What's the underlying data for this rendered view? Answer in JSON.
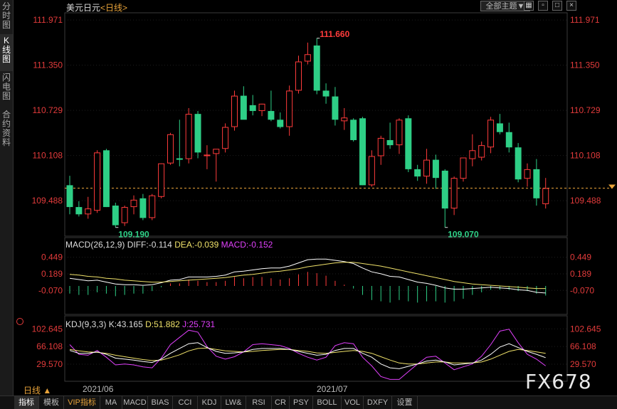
{
  "left_tabs": [
    {
      "label": "分时图",
      "active": false
    },
    {
      "label": "K线图",
      "active": true
    },
    {
      "label": "闪电图",
      "active": false
    },
    {
      "label": "合约资料",
      "active": false
    }
  ],
  "header": {
    "symbol": "美元日元",
    "period": "<日线>",
    "theme_button": "全部主题▼"
  },
  "price_axis_labels": [
    "111.971",
    "111.350",
    "110.729",
    "110.108",
    "109.488"
  ],
  "macd_axis_labels": [
    "0.449",
    "0.189",
    "-0.070"
  ],
  "kdj_axis_labels": [
    "102.645",
    "66.108",
    "29.570"
  ],
  "macd_title": {
    "name": "MACD(26,12,9)",
    "diff": "DIFF:-0.114",
    "dea": "DEA:-0.039",
    "macd": "MACD:-0.152"
  },
  "kdj_title": {
    "name": "KDJ(9,3,3)",
    "k": "K:43.165",
    "d": "D:51.882",
    "j": "J:25.731"
  },
  "date_labels": [
    "2021/06",
    "2021/07"
  ],
  "period_button": "日线 ▲",
  "bottom_tabs": [
    "指标",
    "模板",
    "VIP指标",
    "MA",
    "MACD",
    "BIAS",
    "CCI",
    "KDJ",
    "LW&",
    "RSI",
    "CR",
    "PSY",
    "BOLL",
    "VOL",
    "DXFY",
    "设置"
  ],
  "watermark": "FX678",
  "colors": {
    "up": "#ff3b3b",
    "down": "#2ecf86",
    "dif": "#ffffff",
    "dea": "#f0e26a",
    "j": "#e040fb",
    "axis_text": "#e33b3b"
  },
  "chart_data": {
    "type": "candlestick",
    "symbol": "USDJPY",
    "period": "daily",
    "ylim": [
      109.0,
      112.05
    ],
    "current_price": 109.66,
    "annotations": {
      "max": "111.660",
      "min_left": "109.190",
      "min_right": "109.070"
    },
    "ohlc": [
      [
        109.7,
        109.83,
        109.3,
        109.4
      ],
      [
        109.4,
        109.48,
        109.27,
        109.3
      ],
      [
        109.3,
        109.54,
        109.24,
        109.38
      ],
      [
        109.35,
        110.18,
        109.32,
        110.15
      ],
      [
        110.18,
        110.2,
        109.4,
        109.4
      ],
      [
        109.42,
        109.46,
        109.12,
        109.15
      ],
      [
        109.18,
        109.42,
        109.14,
        109.4
      ],
      [
        109.4,
        109.56,
        109.3,
        109.5
      ],
      [
        109.52,
        109.58,
        109.22,
        109.25
      ],
      [
        109.25,
        109.58,
        109.22,
        109.56
      ],
      [
        109.54,
        110.0,
        109.52,
        110.0
      ],
      [
        110.0,
        110.42,
        109.98,
        110.4
      ],
      [
        110.07,
        110.6,
        109.96,
        110.05
      ],
      [
        110.06,
        110.76,
        110.0,
        110.68
      ],
      [
        110.68,
        110.72,
        110.07,
        110.15
      ],
      [
        110.1,
        110.25,
        109.92,
        110.12
      ],
      [
        110.13,
        110.19,
        109.75,
        110.2
      ],
      [
        110.2,
        110.55,
        110.15,
        110.5
      ],
      [
        110.5,
        111.0,
        110.45,
        110.93
      ],
      [
        110.93,
        111.06,
        110.65,
        110.6
      ],
      [
        110.8,
        110.94,
        110.66,
        110.72
      ],
      [
        110.72,
        110.82,
        110.65,
        110.82
      ],
      [
        110.72,
        111.0,
        110.58,
        110.6
      ],
      [
        110.6,
        110.7,
        110.48,
        110.5
      ],
      [
        110.5,
        111.07,
        110.38,
        111.0
      ],
      [
        111.0,
        111.48,
        110.96,
        111.4
      ],
      [
        111.4,
        111.66,
        111.36,
        111.5
      ],
      [
        111.62,
        111.72,
        110.95,
        111.0
      ],
      [
        111.0,
        111.1,
        110.82,
        110.92
      ],
      [
        110.92,
        111.05,
        110.52,
        110.6
      ],
      [
        110.58,
        110.76,
        110.46,
        110.63
      ],
      [
        110.6,
        110.62,
        110.3,
        110.32
      ],
      [
        110.62,
        110.64,
        109.7,
        109.7
      ],
      [
        109.7,
        110.18,
        109.68,
        110.1
      ],
      [
        110.1,
        110.38,
        109.98,
        110.35
      ],
      [
        110.32,
        110.56,
        110.2,
        110.25
      ],
      [
        110.25,
        110.62,
        110.13,
        110.6
      ],
      [
        110.62,
        110.66,
        109.88,
        109.92
      ],
      [
        109.92,
        109.98,
        109.76,
        109.82
      ],
      [
        109.82,
        110.2,
        109.72,
        110.05
      ],
      [
        110.05,
        110.12,
        109.65,
        109.8
      ],
      [
        109.9,
        109.92,
        109.12,
        109.38
      ],
      [
        109.38,
        109.82,
        109.29,
        109.8
      ],
      [
        109.79,
        110.05,
        109.75,
        110.08
      ],
      [
        110.06,
        110.4,
        109.96,
        110.18
      ],
      [
        110.08,
        110.3,
        110.04,
        110.25
      ],
      [
        110.22,
        110.64,
        110.14,
        110.6
      ],
      [
        110.55,
        110.68,
        110.4,
        110.43
      ],
      [
        110.43,
        110.56,
        110.15,
        110.22
      ],
      [
        110.22,
        110.28,
        109.74,
        109.78
      ],
      [
        109.79,
        110.0,
        109.68,
        109.92
      ],
      [
        109.92,
        110.06,
        109.42,
        109.52
      ],
      [
        109.44,
        109.8,
        109.38,
        109.66
      ]
    ],
    "macd": {
      "ylim": [
        -0.4,
        0.6
      ],
      "dif": [
        0.12,
        0.1,
        0.08,
        0.09,
        0.06,
        0.03,
        0.02,
        0.02,
        0.01,
        0.02,
        0.05,
        0.09,
        0.1,
        0.14,
        0.14,
        0.14,
        0.15,
        0.17,
        0.22,
        0.23,
        0.25,
        0.27,
        0.28,
        0.28,
        0.31,
        0.36,
        0.41,
        0.42,
        0.42,
        0.4,
        0.38,
        0.35,
        0.28,
        0.22,
        0.19,
        0.15,
        0.14,
        0.1,
        0.06,
        0.04,
        0.01,
        -0.03,
        -0.05,
        -0.05,
        -0.04,
        -0.03,
        -0.02,
        -0.03,
        -0.04,
        -0.06,
        -0.07,
        -0.1,
        -0.11
      ],
      "dea": [
        0.18,
        0.17,
        0.15,
        0.14,
        0.12,
        0.11,
        0.09,
        0.08,
        0.07,
        0.06,
        0.06,
        0.07,
        0.08,
        0.09,
        0.1,
        0.11,
        0.12,
        0.13,
        0.15,
        0.17,
        0.18,
        0.2,
        0.22,
        0.23,
        0.25,
        0.27,
        0.3,
        0.32,
        0.34,
        0.36,
        0.37,
        0.37,
        0.35,
        0.33,
        0.31,
        0.28,
        0.25,
        0.22,
        0.19,
        0.16,
        0.13,
        0.1,
        0.07,
        0.05,
        0.03,
        0.02,
        0.01,
        0.0,
        -0.01,
        -0.02,
        -0.03,
        -0.04,
        -0.04
      ],
      "hist": [
        -0.12,
        -0.14,
        -0.14,
        -0.1,
        -0.12,
        -0.16,
        -0.14,
        -0.12,
        -0.12,
        -0.08,
        -0.02,
        0.04,
        0.04,
        0.1,
        0.08,
        0.06,
        0.06,
        0.08,
        0.14,
        0.12,
        0.14,
        0.14,
        0.12,
        0.1,
        0.12,
        0.18,
        0.22,
        0.2,
        0.16,
        0.08,
        0.02,
        -0.04,
        -0.14,
        -0.22,
        -0.24,
        -0.26,
        -0.22,
        -0.24,
        -0.26,
        -0.24,
        -0.24,
        -0.26,
        -0.24,
        -0.2,
        -0.14,
        -0.1,
        -0.06,
        -0.06,
        -0.06,
        -0.08,
        -0.08,
        -0.12,
        -0.15
      ]
    },
    "kdj": {
      "ylim": [
        0,
        115
      ],
      "k": [
        58,
        52,
        52,
        55,
        50,
        42,
        40,
        38,
        35,
        33,
        40,
        52,
        62,
        72,
        74,
        64,
        56,
        52,
        53,
        55,
        60,
        62,
        62,
        62,
        60,
        56,
        52,
        48,
        50,
        58,
        62,
        62,
        52,
        44,
        30,
        22,
        20,
        25,
        30,
        36,
        38,
        34,
        28,
        30,
        32,
        38,
        50,
        65,
        72,
        64,
        56,
        50,
        43
      ],
      "d": [
        60,
        57,
        55,
        54,
        52,
        48,
        45,
        42,
        39,
        37,
        38,
        43,
        49,
        57,
        62,
        63,
        60,
        57,
        56,
        55,
        56,
        58,
        59,
        60,
        60,
        58,
        56,
        53,
        52,
        54,
        56,
        58,
        56,
        52,
        45,
        38,
        32,
        30,
        30,
        32,
        34,
        34,
        32,
        32,
        32,
        34,
        40,
        48,
        56,
        60,
        58,
        55,
        52
      ],
      "j": [
        70,
        50,
        48,
        58,
        44,
        28,
        30,
        28,
        24,
        22,
        42,
        70,
        85,
        100,
        96,
        66,
        46,
        40,
        45,
        55,
        70,
        72,
        70,
        68,
        62,
        52,
        44,
        38,
        44,
        68,
        74,
        72,
        44,
        26,
        4,
        -2,
        -2,
        14,
        30,
        44,
        46,
        32,
        18,
        24,
        30,
        46,
        70,
        98,
        102,
        74,
        50,
        40,
        26
      ]
    }
  }
}
